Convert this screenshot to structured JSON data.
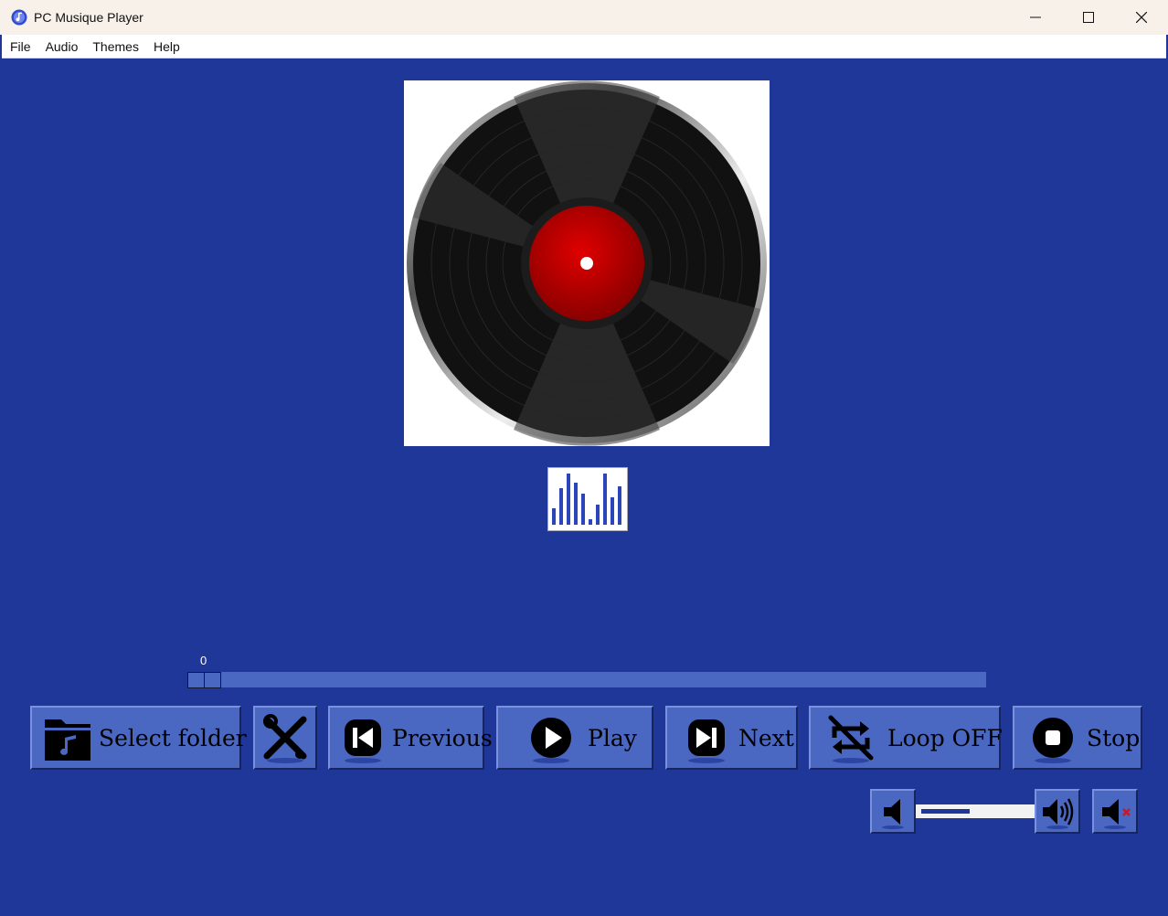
{
  "window": {
    "title": "PC Musique Player"
  },
  "menu": {
    "items": [
      "File",
      "Audio",
      "Themes",
      "Help"
    ]
  },
  "seek": {
    "value": "0",
    "progress": 0
  },
  "controls": {
    "select_folder": "Select folder",
    "previous": "Previous",
    "play": "Play",
    "next": "Next",
    "loop": "Loop OFF",
    "stop": "Stop"
  },
  "volume": {
    "level": 0.45
  },
  "colors": {
    "background": "#1f3799",
    "button": "#4a67c2",
    "titlebar": "#f7f1ea",
    "label_red": "#c40000"
  },
  "icons": {
    "app": "music-note-icon",
    "folder": "music-folder-icon",
    "clear": "cross-tools-icon",
    "previous": "skip-previous-icon",
    "play": "play-icon",
    "next": "skip-next-icon",
    "loop": "loop-off-icon",
    "stop": "stop-icon",
    "volume_down": "speaker-low-icon",
    "volume_up": "speaker-high-icon",
    "mute": "speaker-mute-icon",
    "equalizer": "equalizer-icon"
  }
}
